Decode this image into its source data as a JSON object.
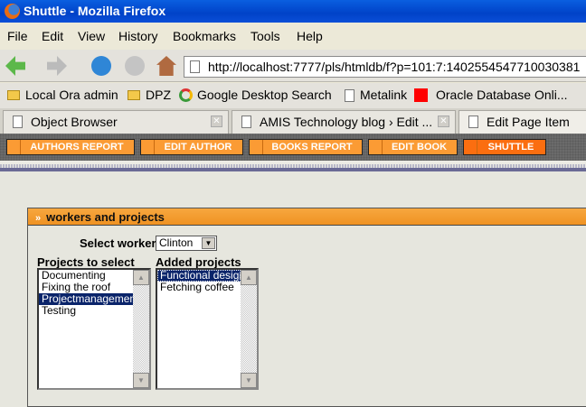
{
  "window": {
    "title": "Shuttle - Mozilla Firefox"
  },
  "menu": [
    "File",
    "Edit",
    "View",
    "History",
    "Bookmarks",
    "Tools",
    "Help"
  ],
  "url": "http://localhost:7777/pls/htmldb/f?p=101:7:1402554547710030381",
  "bookmarks": [
    "Local Ora admin",
    "DPZ",
    "Google Desktop Search",
    "Metalink",
    "Oracle Database Onli..."
  ],
  "tabs": [
    "Object Browser",
    "AMIS Technology blog › Edit ...",
    "Edit Page Item"
  ],
  "app_nav": [
    "AUTHORS REPORT",
    "EDIT AUTHOR",
    "BOOKS REPORT",
    "EDIT BOOK",
    "SHUTTLE"
  ],
  "region": {
    "title": "workers and projects",
    "worker_label": "Select worker",
    "worker_value": "Clinton",
    "left_label": "Projects to select",
    "left_items": [
      "Documenting",
      "Fixing the roof",
      "Projectmanagement",
      "Testing"
    ],
    "right_label": "Added projects",
    "right_items": [
      "Functional design",
      "Fetching coffee"
    ]
  }
}
